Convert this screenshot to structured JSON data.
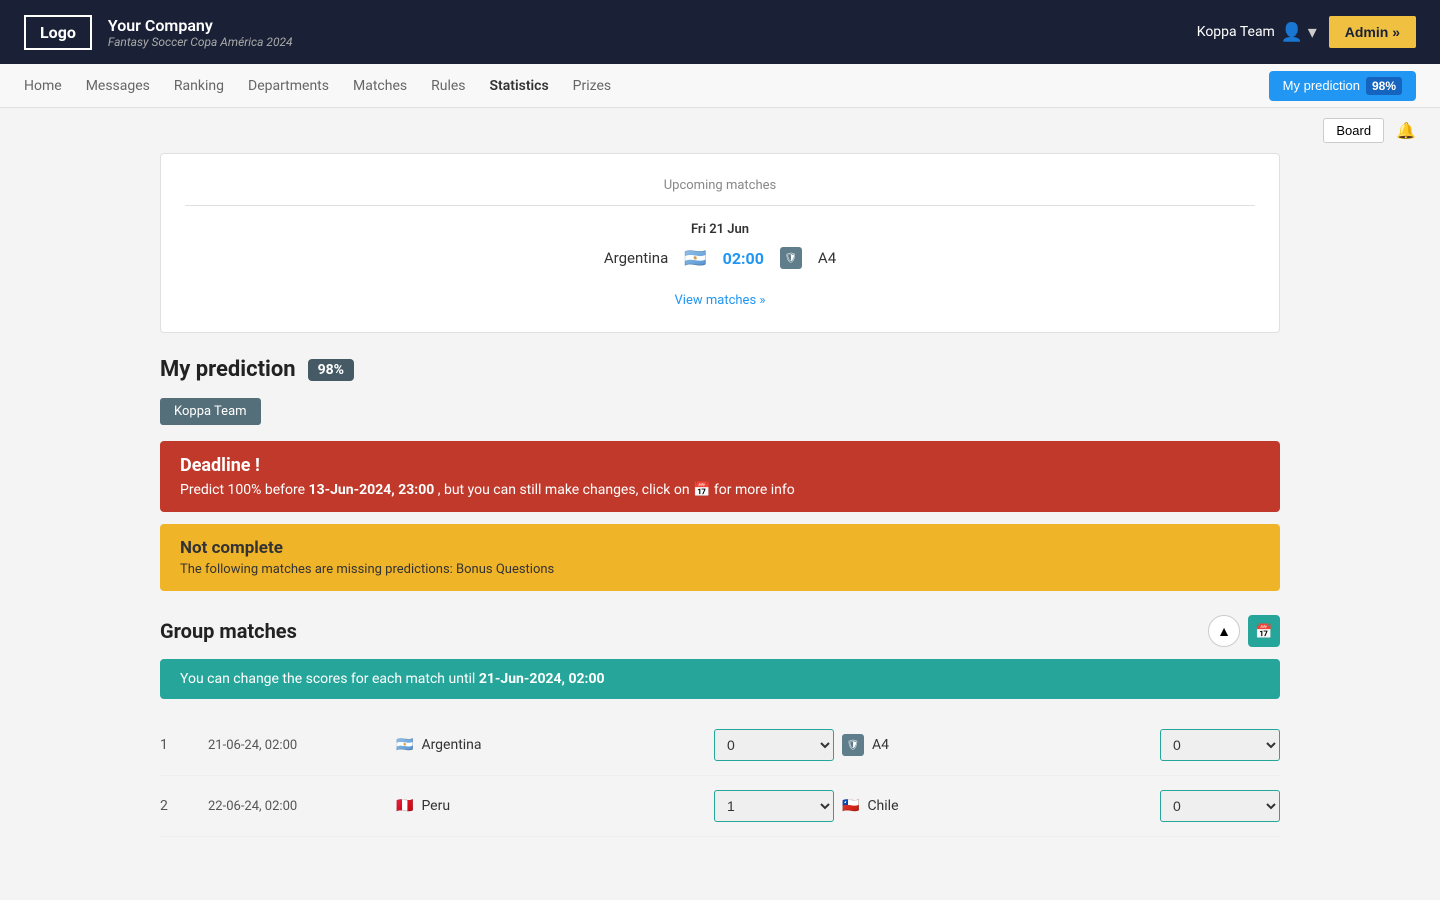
{
  "header": {
    "logo_text": "Logo",
    "company_name": "Your Company",
    "company_subtitle": "Fantasy Soccer Copa América 2024",
    "user_name": "Koppa Team",
    "admin_button": "Admin »"
  },
  "nav": {
    "links": [
      {
        "label": "Home",
        "active": false
      },
      {
        "label": "Messages",
        "active": false
      },
      {
        "label": "Ranking",
        "active": false
      },
      {
        "label": "Departments",
        "active": false
      },
      {
        "label": "Matches",
        "active": false
      },
      {
        "label": "Rules",
        "active": false
      },
      {
        "label": "Statistics",
        "active": true
      },
      {
        "label": "Prizes",
        "active": false
      }
    ],
    "my_prediction_label": "My prediction",
    "my_prediction_pct": "98%"
  },
  "toolbar": {
    "board_label": "Board"
  },
  "upcoming": {
    "title": "Upcoming matches",
    "date": "Fri 21 Jun",
    "team1": "Argentina",
    "time": "02:00",
    "team2": "A4",
    "view_matches": "View matches »"
  },
  "prediction": {
    "title": "My prediction",
    "pct": "98%",
    "team_tag": "Koppa Team",
    "deadline_title": "Deadline !",
    "deadline_text": "Predict 100% before ",
    "deadline_date": "13-Jun-2024, 23:00",
    "deadline_suffix": " , but you can still make changes, click on 📅 for more info",
    "not_complete_title": "Not complete",
    "not_complete_text": "The following matches are missing predictions: Bonus Questions"
  },
  "group_matches": {
    "title": "Group matches",
    "info_text": "You can change the scores for each match until ",
    "info_date": "21-Jun-2024, 02:00",
    "matches": [
      {
        "num": "1",
        "datetime": "21-06-24, 02:00",
        "team1": "Argentina",
        "team1_flag": "🇦🇷",
        "score1": "0",
        "team2": "A4",
        "team2_shield": true,
        "score2": "0"
      },
      {
        "num": "2",
        "datetime": "22-06-24, 02:00",
        "team1": "Peru",
        "team1_flag": "🇵🇪",
        "score1": "1",
        "team2": "Chile",
        "team2_flag": "🇨🇱",
        "score2": "0"
      }
    ]
  }
}
